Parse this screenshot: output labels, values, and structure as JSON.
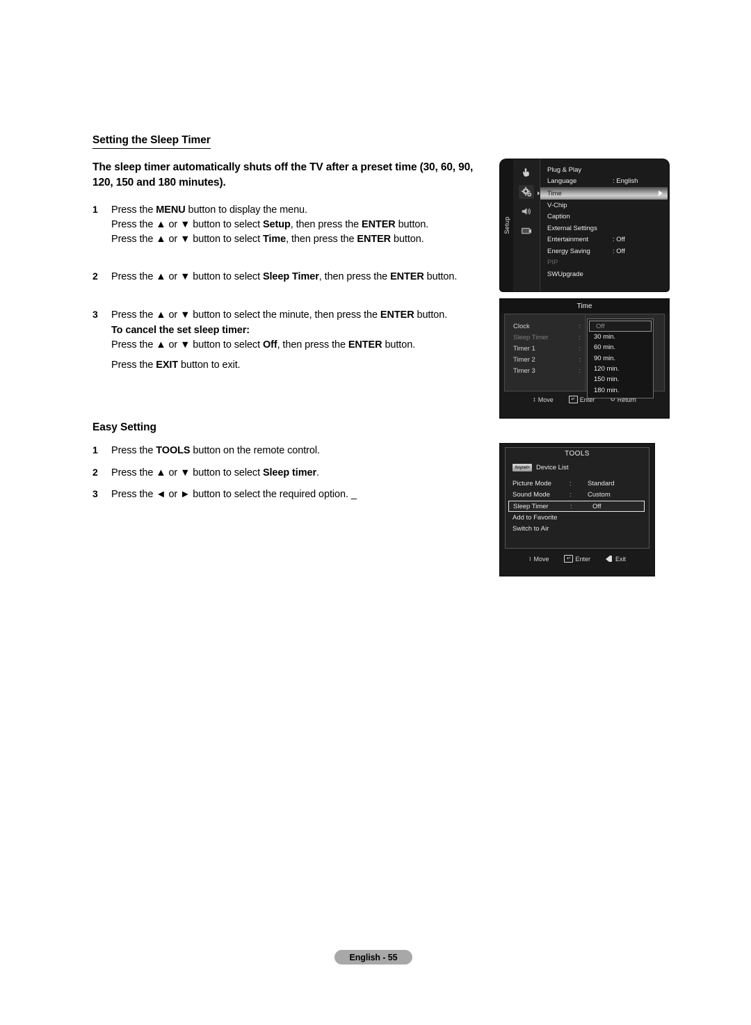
{
  "document": {
    "section_heading": "Setting the Sleep Timer",
    "lead_paragraph": "The sleep timer automatically shuts off the TV after a preset time (30, 60, 90, 120, 150 and 180 minutes).",
    "steps": [
      {
        "num": "1",
        "lines": [
          {
            "parts": [
              {
                "t": "Press the ",
                "b": false
              },
              {
                "t": "MENU",
                "b": true
              },
              {
                "t": " button to display the menu.",
                "b": false
              }
            ]
          },
          {
            "parts": [
              {
                "t": "Press the ▲ or ▼ button to select ",
                "b": false
              },
              {
                "t": "Setup",
                "b": true
              },
              {
                "t": ", then press the ",
                "b": false
              },
              {
                "t": "ENTER",
                "b": true
              },
              {
                "t": " button.",
                "b": false
              }
            ]
          },
          {
            "parts": [
              {
                "t": "Press the ▲ or ▼ button to select ",
                "b": false
              },
              {
                "t": "Time",
                "b": true
              },
              {
                "t": ", then press the ",
                "b": false
              },
              {
                "t": "ENTER",
                "b": true
              },
              {
                "t": " button.",
                "b": false
              }
            ]
          }
        ]
      },
      {
        "num": "2",
        "lines": [
          {
            "parts": [
              {
                "t": "Press the ▲ or ▼ button to select ",
                "b": false
              },
              {
                "t": "Sleep Timer",
                "b": true
              },
              {
                "t": ", then press the ",
                "b": false
              },
              {
                "t": "ENTER",
                "b": true
              },
              {
                "t": " button.",
                "b": false
              }
            ]
          }
        ]
      },
      {
        "num": "3",
        "lines": [
          {
            "parts": [
              {
                "t": "Press the ▲ or ▼ button to select the minute, then press the ",
                "b": false
              },
              {
                "t": "ENTER",
                "b": true
              },
              {
                "t": " button.",
                "b": false
              }
            ]
          }
        ],
        "sub_heading": "To cancel the set sleep timer:",
        "after_lines": [
          {
            "parts": [
              {
                "t": "Press the ▲ or ▼ button to select ",
                "b": false
              },
              {
                "t": "Off",
                "b": true
              },
              {
                "t": ", then press the ",
                "b": false
              },
              {
                "t": "ENTER",
                "b": true
              },
              {
                "t": " button.",
                "b": false
              }
            ]
          },
          {
            "parts": [
              {
                "t": "Press the ",
                "b": false
              },
              {
                "t": "EXIT",
                "b": true
              },
              {
                "t": " button to exit.",
                "b": false
              }
            ]
          }
        ]
      }
    ],
    "easy_setting": {
      "title": "Easy Setting",
      "steps": [
        {
          "num": "1",
          "parts": [
            {
              "t": "Press the ",
              "b": false
            },
            {
              "t": "TOOLS",
              "b": true
            },
            {
              "t": " button on the remote control.",
              "b": false
            }
          ]
        },
        {
          "num": "2",
          "parts": [
            {
              "t": "Press the ▲ or ▼ button to select ",
              "b": false
            },
            {
              "t": "Sleep timer",
              "b": true
            },
            {
              "t": ".",
              "b": false
            }
          ]
        },
        {
          "num": "3",
          "parts": [
            {
              "t": "Press the ◄ or ► button to select the required option. ",
              "b": false
            },
            {
              "t": "_",
              "b": false
            }
          ]
        }
      ]
    },
    "footer_label": "English - 55"
  },
  "setup_menu": {
    "rail_label": "Setup",
    "icons": [
      "hand-pointer-icon",
      "gear-icon",
      "speaker-icon",
      "display-icon"
    ],
    "items": [
      {
        "label": "Plug & Play",
        "value": "",
        "state": "normal"
      },
      {
        "label": "Language",
        "value": ": English",
        "state": "normal"
      },
      {
        "label": "Time",
        "value": "",
        "state": "selected"
      },
      {
        "label": "V-Chip",
        "value": "",
        "state": "normal"
      },
      {
        "label": "Caption",
        "value": "",
        "state": "normal"
      },
      {
        "label": "External Settings",
        "value": "",
        "state": "normal"
      },
      {
        "label": "Entertainment",
        "value": ": Off",
        "state": "normal"
      },
      {
        "label": "Energy Saving",
        "value": ": Off",
        "state": "normal"
      },
      {
        "label": "PIP",
        "value": "",
        "state": "dim"
      },
      {
        "label": "SWUpgrade",
        "value": "",
        "state": "normal"
      }
    ]
  },
  "time_menu": {
    "title": "Time",
    "rows": [
      {
        "label": "Clock",
        "state": "normal"
      },
      {
        "label": "Sleep Timer",
        "state": "dim"
      },
      {
        "label": "Timer 1",
        "state": "normal"
      },
      {
        "label": "Timer 2",
        "state": "normal"
      },
      {
        "label": "Timer 3",
        "state": "normal"
      }
    ],
    "dropdown": {
      "options": [
        "Off",
        "30 min.",
        "60 min.",
        "90 min.",
        "120 min.",
        "150 min.",
        "180 min."
      ],
      "current": "Off"
    },
    "footer": [
      {
        "icon": "move-updown-icon",
        "label": "Move"
      },
      {
        "icon": "enter-icon",
        "label": "Enter"
      },
      {
        "icon": "return-icon",
        "label": "Return"
      }
    ]
  },
  "tools_menu": {
    "title": "TOOLS",
    "device_list": {
      "badge": "Anynet+",
      "label": "Device List"
    },
    "rows": [
      {
        "label": "Picture Mode",
        "colon": ":",
        "value": "Standard",
        "state": "normal"
      },
      {
        "label": "Sound Mode",
        "colon": ":",
        "value": "Custom",
        "state": "normal"
      },
      {
        "label": "Sleep Timer",
        "colon": ":",
        "value": "Off",
        "state": "selected"
      },
      {
        "label": "Add to Favorite",
        "colon": "",
        "value": "",
        "state": "normal"
      },
      {
        "label": "Switch to Air",
        "colon": "",
        "value": "",
        "state": "normal"
      }
    ],
    "footer": [
      {
        "icon": "move-updown-icon",
        "label": "Move"
      },
      {
        "icon": "enter-icon",
        "label": "Enter"
      },
      {
        "icon": "exit-icon",
        "label": "Exit"
      }
    ]
  },
  "colors": {
    "osd_background": "#1a1a1a",
    "osd_text": "#e8e8e8",
    "osd_dim_text": "#7d7d7d",
    "highlight_gradient_light": "#cfcfcf",
    "footer_pill": "#a8a8a8"
  }
}
